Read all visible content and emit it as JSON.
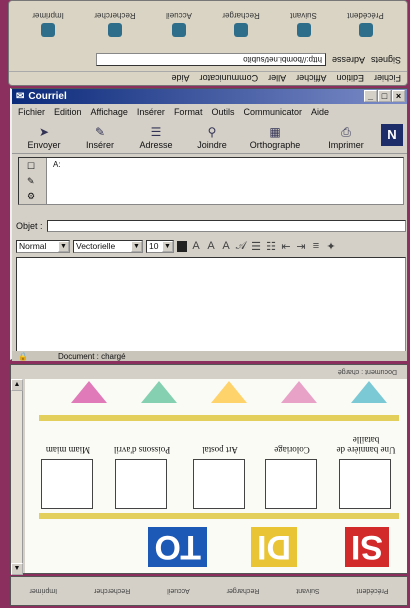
{
  "top_browser": {
    "menu": [
      "Fichier",
      "Edition",
      "Afficher",
      "Aller",
      "Communicator",
      "Aide"
    ],
    "location_label": "Signets",
    "address_label": "Adresse",
    "url": "http://bombi.net/subito",
    "nav_buttons": [
      "Précédent",
      "Suivant",
      "Recharger",
      "Accueil",
      "Rechercher",
      "Imprimer"
    ]
  },
  "mail_window": {
    "title": "Courriel",
    "menu": [
      "Fichier",
      "Edition",
      "Affichage",
      "Insérer",
      "Format",
      "Outils",
      "Communicator",
      "Aide"
    ],
    "toolbar": [
      {
        "label": "Envoyer",
        "icon": "send-icon"
      },
      {
        "label": "Insérer",
        "icon": "insert-icon"
      },
      {
        "label": "Adresse",
        "icon": "address-icon"
      },
      {
        "label": "Joindre",
        "icon": "attach-icon"
      },
      {
        "label": "Orthographe",
        "icon": "spellcheck-icon"
      },
      {
        "label": "Imprimer",
        "icon": "print-icon"
      }
    ],
    "recipient_field": "A:",
    "subject_label": "Objet :",
    "subject_value": "",
    "format": {
      "paragraph": "Normal",
      "font": "Vectorielle",
      "size": "10"
    },
    "status": "Document : chargé"
  },
  "content_window": {
    "status": "Document : chargé",
    "big_words": [
      "SI",
      "DI",
      "TO"
    ],
    "captions": [
      "Une bannière de bataille",
      "Coloriage",
      "Art postal",
      "Poissons d'avril",
      "Miam miam"
    ]
  },
  "bottom_nav": [
    "Précédent",
    "Suivant",
    "Recharger",
    "Accueil",
    "Rechercher",
    "Imprimer"
  ]
}
